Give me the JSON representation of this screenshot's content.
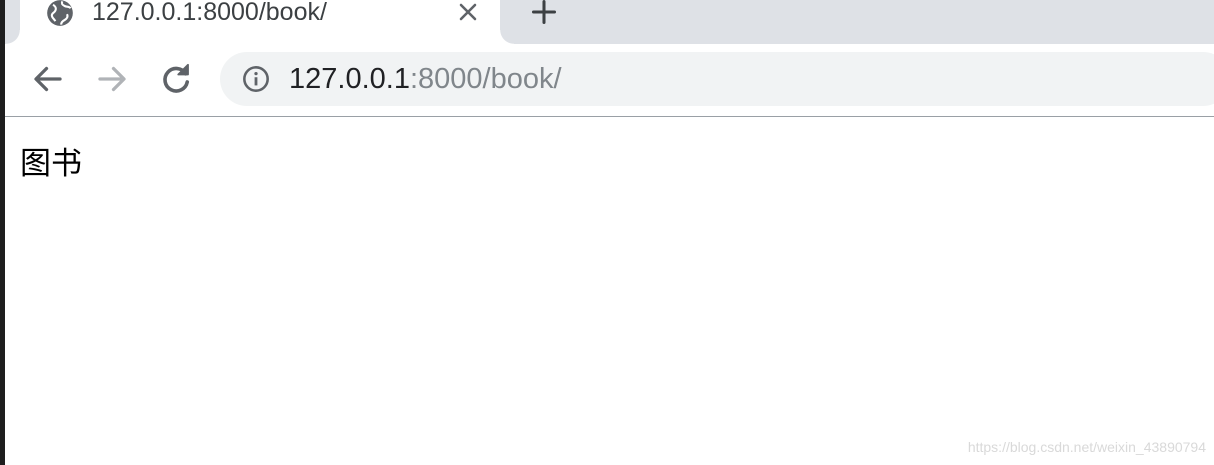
{
  "browser": {
    "tab": {
      "title": "127.0.0.1:8000/book/",
      "favicon": "globe-icon"
    },
    "address_bar": {
      "host": "127.0.0.1",
      "rest": ":8000/book/",
      "security_icon": "info-icon"
    }
  },
  "page": {
    "heading": "图书"
  },
  "watermark": "https://blog.csdn.net/weixin_43890794",
  "colors": {
    "tabstrip": "#dee1e6",
    "omnibox": "#f1f3f4",
    "icon": "#5f6368",
    "icon_disabled": "#b0b3b7"
  }
}
